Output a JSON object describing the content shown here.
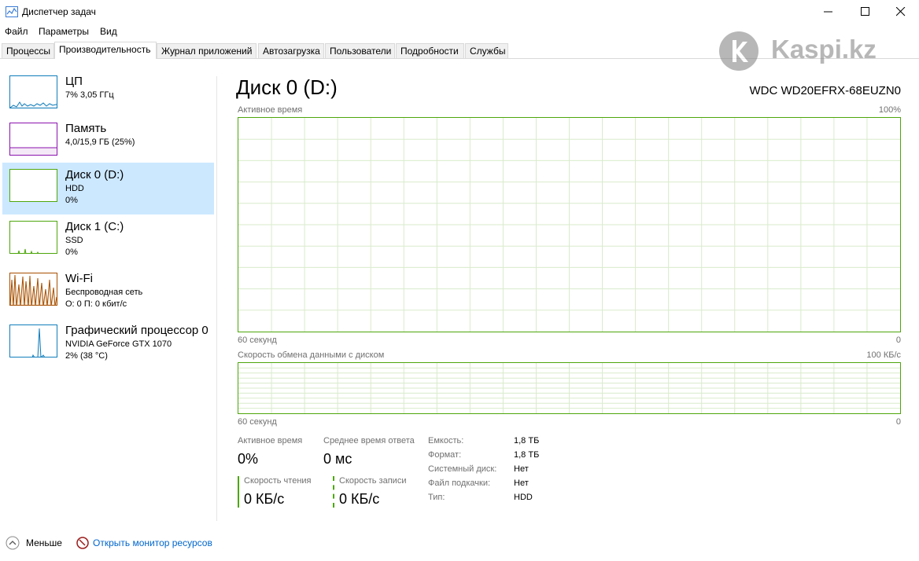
{
  "window": {
    "title": "Диспетчер задач"
  },
  "menu": [
    "Файл",
    "Параметры",
    "Вид"
  ],
  "tabs": [
    "Процессы",
    "Производительность",
    "Журнал приложений",
    "Автозагрузка",
    "Пользователи",
    "Подробности",
    "Службы"
  ],
  "active_tab": "Производительность",
  "watermark": {
    "text": "Kaspi.kz"
  },
  "sidebar": {
    "items": [
      {
        "name": "ЦП",
        "sub1": "7% 3,05 ГГц",
        "sub2": "",
        "color": "#117dbb"
      },
      {
        "name": "Память",
        "sub1": "4,0/15,9 ГБ (25%)",
        "sub2": "",
        "color": "#8b12ae"
      },
      {
        "name": "Диск 0 (D:)",
        "sub1": "HDD",
        "sub2": "0%",
        "color": "#4da60c"
      },
      {
        "name": "Диск 1 (C:)",
        "sub1": "SSD",
        "sub2": "0%",
        "color": "#4da60c"
      },
      {
        "name": "Wi-Fi",
        "sub1": "Беспроводная сеть",
        "sub2": "О: 0 П: 0 кбит/с",
        "color": "#a74f01"
      },
      {
        "name": "Графический процессор 0",
        "sub1": "NVIDIA GeForce GTX 1070",
        "sub2": "2% (38 °C)",
        "color": "#117dbb"
      }
    ],
    "selected_index": 2
  },
  "main": {
    "title": "Диск 0 (D:)",
    "model": "WDC WD20EFRX-68EUZN0",
    "graph1": {
      "label": "Активное время",
      "max": "100%",
      "time": "60 секунд",
      "min": "0"
    },
    "graph2": {
      "label": "Скорость обмена данными с диском",
      "max": "100 КБ/с",
      "time": "60 секунд",
      "min": "0"
    },
    "stats": {
      "active_time_label": "Активное время",
      "active_time_value": "0%",
      "avg_response_label": "Среднее время ответа",
      "avg_response_value": "0 мс",
      "read_label": "Скорость чтения",
      "read_value": "0 КБ/с",
      "write_label": "Скорость записи",
      "write_value": "0 КБ/с"
    },
    "properties": [
      {
        "key": "Емкость:",
        "value": "1,8 ТБ"
      },
      {
        "key": "Формат:",
        "value": "1,8 ТБ"
      },
      {
        "key": "Системный диск:",
        "value": "Нет"
      },
      {
        "key": "Файл подкачки:",
        "value": "Нет"
      },
      {
        "key": "Тип:",
        "value": "HDD"
      }
    ]
  },
  "footer": {
    "less": "Меньше",
    "resource_monitor": "Открыть монитор ресурсов"
  },
  "colors": {
    "disk_green": "#4da60c",
    "cpu_blue": "#117dbb",
    "memory_purple": "#8b12ae",
    "wifi_brown": "#a74f01",
    "link_blue": "#0066cc",
    "selected_bg": "#cce8ff"
  }
}
